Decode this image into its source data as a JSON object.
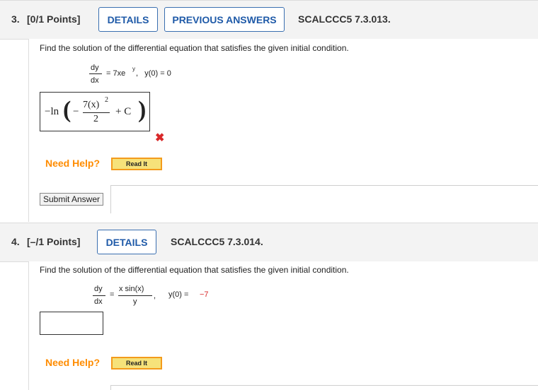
{
  "q3": {
    "number": "3.",
    "points": "[0/1 Points]",
    "details_label": "DETAILS",
    "previous_answers_label": "PREVIOUS ANSWERS",
    "code": "SCALCCC5 7.3.013.",
    "prompt": "Find the solution of the differential equation that satisfies the given initial condition.",
    "eq_num": "dy",
    "eq_den": "dx",
    "eq_rhs": "= 7xe",
    "eq_rhs_sup": "y",
    "eq_ic": ",   y(0) = 0",
    "answer_prefix": "−ln",
    "answer_minus": "−",
    "answer_frac_num": "7(x)",
    "answer_frac_sup": "2",
    "answer_frac_den": "2",
    "answer_plus_c": "+ C",
    "answer_status": "incorrect",
    "cross_icon": "✖",
    "need_help": "Need Help?",
    "read_it": "Read It",
    "submit_label": "Submit Answer"
  },
  "q4": {
    "number": "4.",
    "points": "[–/1 Points]",
    "details_label": "DETAILS",
    "code": "SCALCCC5 7.3.014.",
    "prompt": "Find the solution of the differential equation that satisfies the given initial condition.",
    "eq_num": "dy",
    "eq_den": "dx",
    "eq_eq": "=",
    "eq_frac_num": "x sin(x)",
    "eq_frac_den": "y",
    "eq_comma": ",",
    "eq_ic": "y(0) = ",
    "eq_ic_value": "−7",
    "need_help": "Need Help?",
    "read_it": "Read It"
  },
  "colors": {
    "accent_blue": "#1f5aa8",
    "need_help_orange": "#ff8c00",
    "incorrect_red": "#d9292a",
    "initial_value_red": "#d9292a"
  }
}
